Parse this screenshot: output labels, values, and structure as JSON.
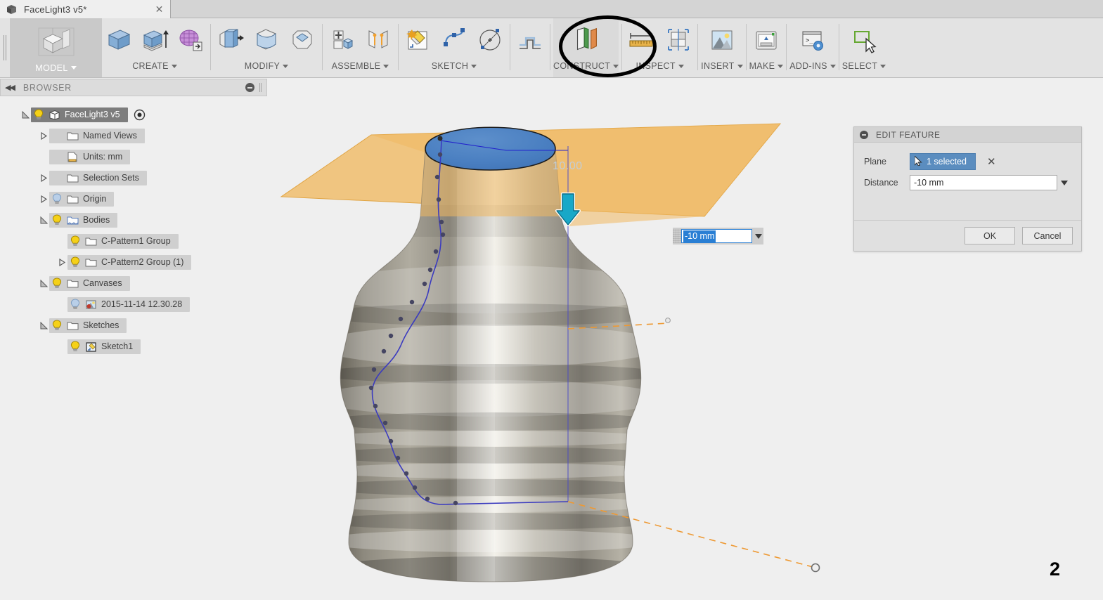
{
  "tab": {
    "title": "FaceLight3 v5*",
    "cube_icon": "cube-icon",
    "close_icon": "close-icon"
  },
  "ribbon": {
    "workspace": {
      "label": "MODEL",
      "icon": "model-workspace-cube-icon"
    },
    "panels": [
      {
        "label": "CREATE",
        "tools": [
          "create-box-icon",
          "create-extrude-icon",
          "create-form-icon"
        ]
      },
      {
        "label": "MODIFY",
        "tools": [
          "modify-press-pull-icon",
          "modify-fillet-icon",
          "modify-chamfer-icon"
        ]
      },
      {
        "label": "ASSEMBLE",
        "tools": [
          "assemble-new-component-icon",
          "assemble-joint-icon"
        ]
      },
      {
        "label": "SKETCH",
        "tools": [
          "sketch-create-icon",
          "sketch-spline-icon",
          "sketch-circle-icon"
        ]
      },
      {
        "label": "CONSTRUCT",
        "tools": [
          "construct-offset-plane-tool-icon",
          "construct-plane-icon"
        ]
      },
      {
        "label": "INSPECT",
        "tools": [
          "inspect-measure-icon",
          "inspect-section-icon"
        ]
      },
      {
        "label": "INSERT",
        "tools": [
          "insert-canvas-image-icon"
        ]
      },
      {
        "label": "MAKE",
        "tools": [
          "make-3d-print-icon"
        ]
      },
      {
        "label": "ADD-INS",
        "tools": [
          "add-ins-script-icon"
        ]
      },
      {
        "label": "SELECT",
        "tools": [
          "select-window-cursor-icon"
        ]
      }
    ]
  },
  "browser": {
    "header": {
      "title": "BROWSER",
      "collapse_icon": "collapse-left-icon",
      "minimize_icon": "minimize-icon"
    },
    "items": [
      {
        "label": "FaceLight3 v5",
        "indent": 0,
        "arrow": "expanded",
        "bulb": "on",
        "icon": "component-icon",
        "selected": true,
        "eye": true
      },
      {
        "label": "Named Views",
        "indent": 1,
        "arrow": "collapsed",
        "bulb": "none",
        "icon": "folder-icon",
        "selected": false,
        "eye": false
      },
      {
        "label": "Units: mm",
        "indent": 1,
        "arrow": "none",
        "bulb": "none",
        "icon": "units-doc-icon",
        "selected": false,
        "eye": false
      },
      {
        "label": "Selection Sets",
        "indent": 1,
        "arrow": "collapsed",
        "bulb": "none",
        "icon": "folder-icon",
        "selected": false,
        "eye": false
      },
      {
        "label": "Origin",
        "indent": 1,
        "arrow": "collapsed",
        "bulb": "off",
        "icon": "folder-icon",
        "selected": false,
        "eye": false
      },
      {
        "label": "Bodies",
        "indent": 1,
        "arrow": "expanded",
        "bulb": "on",
        "icon": "bodies-icon",
        "selected": false,
        "eye": false
      },
      {
        "label": "C-Pattern1 Group",
        "indent": 2,
        "arrow": "none",
        "bulb": "on",
        "icon": "folder-icon",
        "selected": false,
        "eye": false
      },
      {
        "label": "C-Pattern2 Group (1)",
        "indent": 2,
        "arrow": "collapsed",
        "bulb": "on",
        "icon": "folder-icon",
        "selected": false,
        "eye": false
      },
      {
        "label": "Canvases",
        "indent": 1,
        "arrow": "expanded",
        "bulb": "on",
        "icon": "folder-icon",
        "selected": false,
        "eye": false
      },
      {
        "label": "2015-11-14 12.30.28",
        "indent": 2,
        "arrow": "none",
        "bulb": "off",
        "icon": "canvas-image-icon",
        "selected": false,
        "eye": false
      },
      {
        "label": "Sketches",
        "indent": 1,
        "arrow": "expanded",
        "bulb": "on",
        "icon": "folder-icon",
        "selected": false,
        "eye": false
      },
      {
        "label": "Sketch1",
        "indent": 2,
        "arrow": "none",
        "bulb": "on",
        "icon": "sketch-icon",
        "selected": false,
        "eye": false
      }
    ]
  },
  "viewport": {
    "dimension_text": "10.00",
    "inline_value": {
      "value": "-10 mm",
      "caret_icon": "chevron-down-icon",
      "drag_grip_icon": "drag-grip-icon"
    },
    "arrow_manipulator_icon": "offset-arrow-down-icon",
    "colors": {
      "selected_plane": "#4a7fc1",
      "construction_plane": "#f0b860",
      "sketch_curve": "#3b3bbf",
      "dashed_guide": "#ee9933",
      "background": "#efefef"
    }
  },
  "dialog": {
    "title": "EDIT FEATURE",
    "minimize_icon": "minimize-icon",
    "plane_label": "Plane",
    "plane_value": "1 selected",
    "plane_cursor_icon": "select-cursor-icon",
    "clear_icon": "clear-selection-x-icon",
    "distance_label": "Distance",
    "distance_value": "-10 mm",
    "distance_caret_icon": "chevron-down-icon",
    "ok_label": "OK",
    "cancel_label": "Cancel"
  },
  "annotation": {
    "number": "2",
    "highlight_target": "CONSTRUCT"
  }
}
